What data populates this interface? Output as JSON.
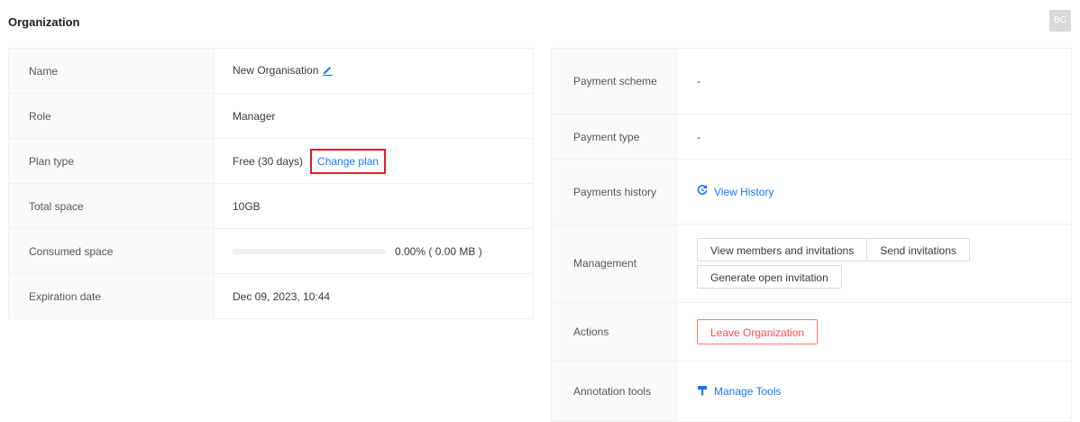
{
  "header": {
    "title": "Organization",
    "avatar_initials": "BC"
  },
  "organization": {
    "name_label": "Name",
    "name_value": "New Organisation",
    "role_label": "Role",
    "role_value": "Manager",
    "plan_label": "Plan type",
    "plan_value": "Free (30 days)",
    "change_plan_label": "Change plan",
    "total_space_label": "Total space",
    "total_space_value": "10GB",
    "consumed_label": "Consumed space",
    "consumed_percent": 0,
    "consumed_text": "0.00% ( 0.00 MB )",
    "expiration_label": "Expiration date",
    "expiration_value": "Dec 09, 2023, 10:44"
  },
  "payment": {
    "scheme_label": "Payment scheme",
    "scheme_value": "-",
    "type_label": "Payment type",
    "type_value": "-",
    "history_label": "Payments history",
    "history_link": "View History",
    "management_label": "Management",
    "view_members_button": "View members and invitations",
    "send_invitations_button": "Send invitations",
    "open_invitation_button": "Generate open invitation",
    "actions_label": "Actions",
    "leave_button": "Leave Organization",
    "annotation_label": "Annotation tools",
    "manage_tools_link": "Manage Tools"
  },
  "colors": {
    "link": "#1677ff",
    "danger": "#ff4d4f",
    "highlight_box": "#d9202b"
  },
  "icons": [
    "edit-icon",
    "history-icon",
    "tools-icon"
  ]
}
